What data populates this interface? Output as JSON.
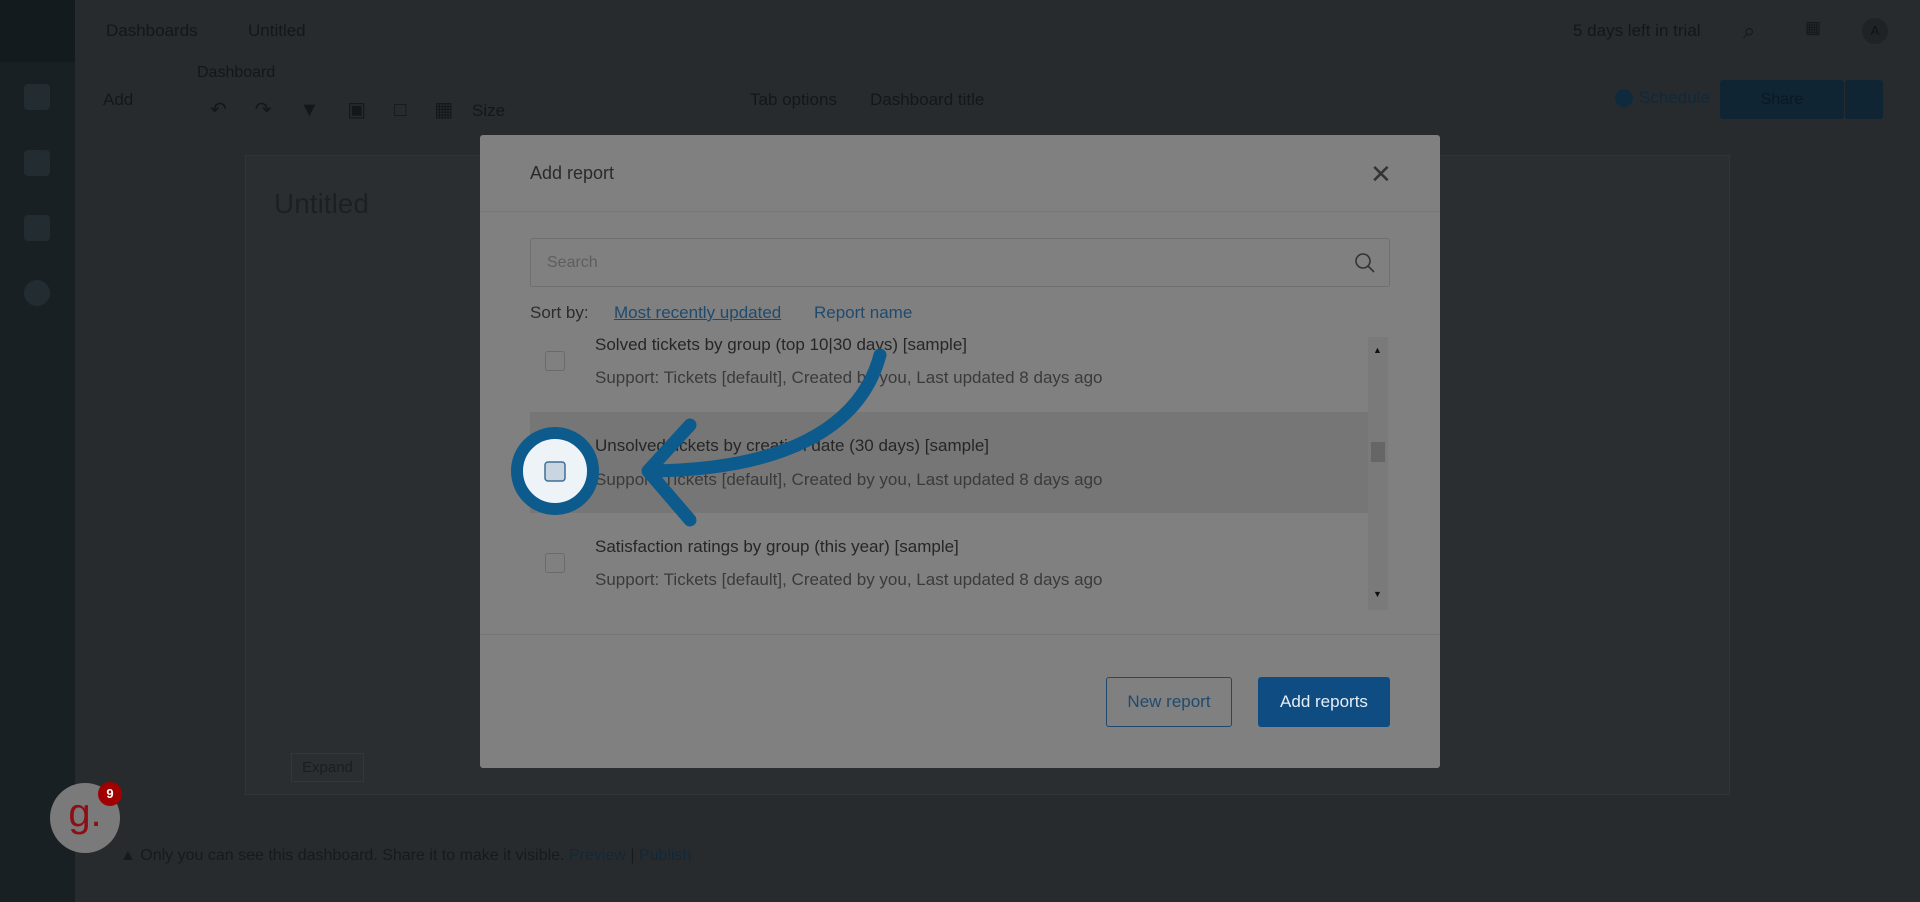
{
  "topbar": {
    "breadcrumb": [
      "Dashboards",
      "Untitled"
    ],
    "trial": "5 days left in trial",
    "avatar": "A"
  },
  "toolbar": {
    "add": "Add",
    "group_label": "Dashboard",
    "size": "Size",
    "tab_options": "Tab options",
    "dashboard_title": "Dashboard title",
    "schedule": "Schedule",
    "share": "Share"
  },
  "canvas": {
    "title": "Untitled",
    "expand": "Expand"
  },
  "footer": {
    "notice": "Only you can see this dashboard. Share it to make it visible.",
    "preview": "Preview",
    "sep": "|",
    "publish": "Publish"
  },
  "widget": {
    "letter": "g.",
    "badge": "9"
  },
  "modal": {
    "title": "Add report",
    "search_placeholder": "Search",
    "sort_label": "Sort by:",
    "sort_options": [
      "Most recently updated",
      "Report name"
    ],
    "reports": [
      {
        "title": "Solved tickets by group (top 10|30 days) [sample]",
        "subtitle": "Support: Tickets [default], Created by you, Last updated 8 days ago"
      },
      {
        "title": "Unsolved tickets by creation date (30 days) [sample]",
        "subtitle": "Support: Tickets [default], Created by you, Last updated 8 days ago"
      },
      {
        "title": "Satisfaction ratings by group (this year) [sample]",
        "subtitle": "Support: Tickets [default], Created by you, Last updated 8 days ago"
      }
    ],
    "new_report": "New report",
    "add_reports": "Add reports"
  },
  "colors": {
    "accent": "#0f4c81",
    "highlight": "#0d5a8c",
    "badge": "#a00000"
  }
}
